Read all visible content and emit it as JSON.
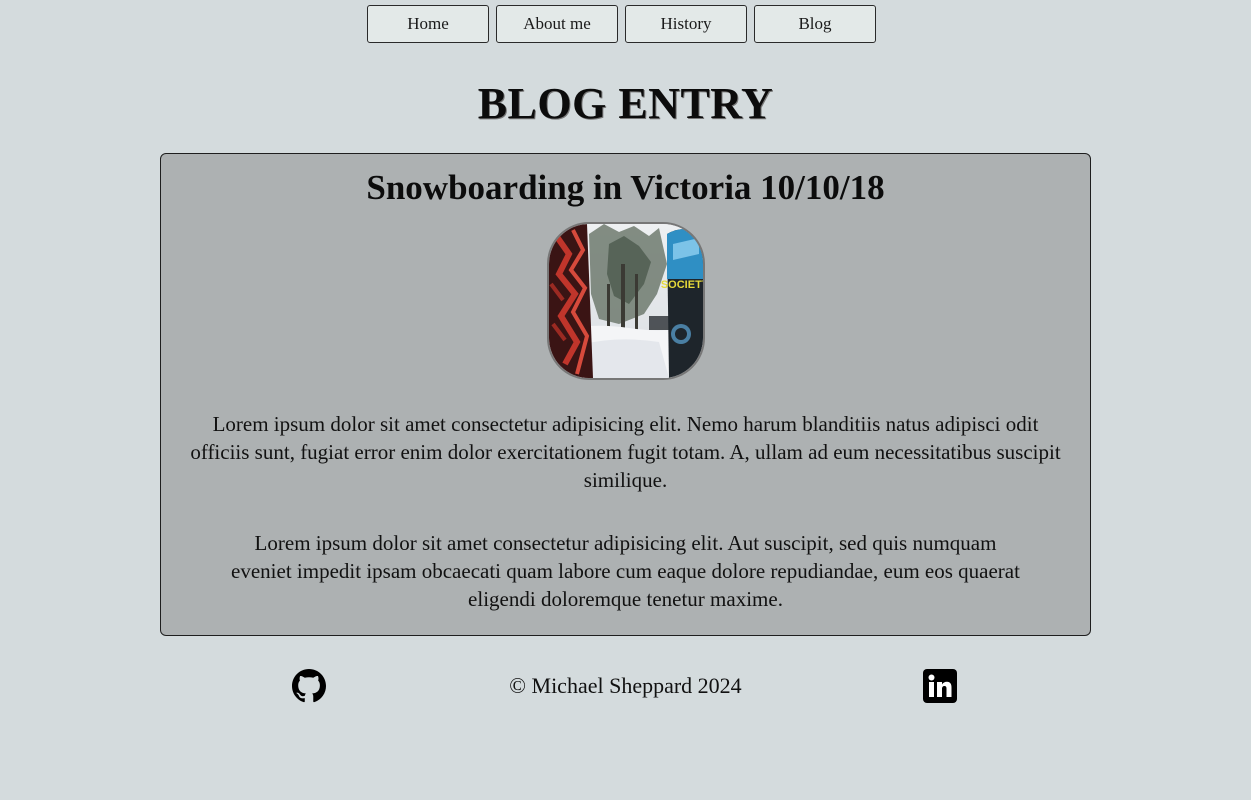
{
  "nav": {
    "items": [
      {
        "label": "Home"
      },
      {
        "label": "About me"
      },
      {
        "label": "History"
      },
      {
        "label": "Blog"
      }
    ]
  },
  "page": {
    "title": "BLOG ENTRY"
  },
  "entry": {
    "title": "Snowboarding in Victoria 10/10/18",
    "photo_icon": "snowboard-photo",
    "board_text": "SOCIETY",
    "paragraphs": [
      "Lorem ipsum dolor sit amet consectetur adipisicing elit. Nemo harum blanditiis natus adipisci odit officiis sunt, fugiat error enim dolor exercitationem fugit totam. A, ullam ad eum necessitatibus suscipit similique.",
      "Lorem ipsum dolor sit amet consectetur adipisicing elit. Aut suscipit, sed quis numquam eveniet impedit ipsam obcaecati quam labore cum eaque dolore repudiandae, eum eos quaerat eligendi doloremque tenetur maxime."
    ]
  },
  "footer": {
    "copyright": "© Michael Sheppard 2024",
    "github_icon": "github-icon",
    "linkedin_icon": "linkedin-icon"
  },
  "colors": {
    "background": "#d4dbdd",
    "card": "#adb1b2",
    "nav_button": "#e3e9e8"
  }
}
